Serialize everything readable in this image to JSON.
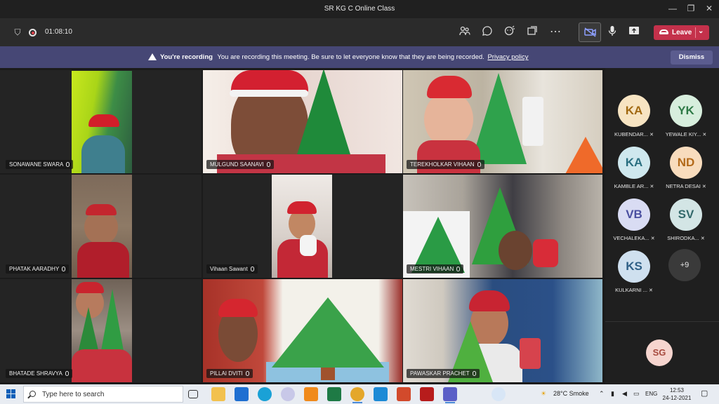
{
  "window": {
    "title": "SR KG C Online Class"
  },
  "toolbar": {
    "timer": "01:08:10",
    "leave_label": "Leave"
  },
  "banner": {
    "bold": "You're recording",
    "message": "You are recording this meeting. Be sure to let everyone know that they are being recorded.",
    "link": "Privacy policy",
    "dismiss_label": "Dismiss"
  },
  "tiles": [
    {
      "name": "SONAWANE SWARA"
    },
    {
      "name": "MULGUND SAANAVI"
    },
    {
      "name": "TEREKHOLKAR VIHAAN"
    },
    {
      "name": "PHATAK AARADHY"
    },
    {
      "name": "Vihaan Sawant"
    },
    {
      "name": "MESTRI VIHAAN"
    },
    {
      "name": "BHATADE SHRAVYA"
    },
    {
      "name": "PILLAI DVITI"
    },
    {
      "name": "PAWASKAR PRACHET"
    }
  ],
  "roster": [
    {
      "initials": "KA",
      "name": "KUBENDAR...",
      "bg": "#f7e4c2",
      "fg": "#a26a12"
    },
    {
      "initials": "YK",
      "name": "YEWALE KIY...",
      "bg": "#d7eedd",
      "fg": "#2f7a47"
    },
    {
      "initials": "KA",
      "name": "KAMBLE AR...",
      "bg": "#cfe8ee",
      "fg": "#2a6f80"
    },
    {
      "initials": "ND",
      "name": "NETRA DESAI",
      "bg": "#f8dcbd",
      "fg": "#b36a1a"
    },
    {
      "initials": "VB",
      "name": "VECHALEKA...",
      "bg": "#d9dcf3",
      "fg": "#4a4fa0"
    },
    {
      "initials": "SV",
      "name": "SHIRODKA...",
      "bg": "#d3e5e5",
      "fg": "#33696b"
    },
    {
      "initials": "KS",
      "name": "KULKARNI ...",
      "bg": "#cfe0ef",
      "fg": "#2f5f86"
    }
  ],
  "roster_more": "+9",
  "self_initials": "SG",
  "taskbar": {
    "search_placeholder": "Type here to search",
    "weather": "28°C  Smoke",
    "lang": "ENG",
    "time": "12:53",
    "date": "24-12-2021"
  }
}
